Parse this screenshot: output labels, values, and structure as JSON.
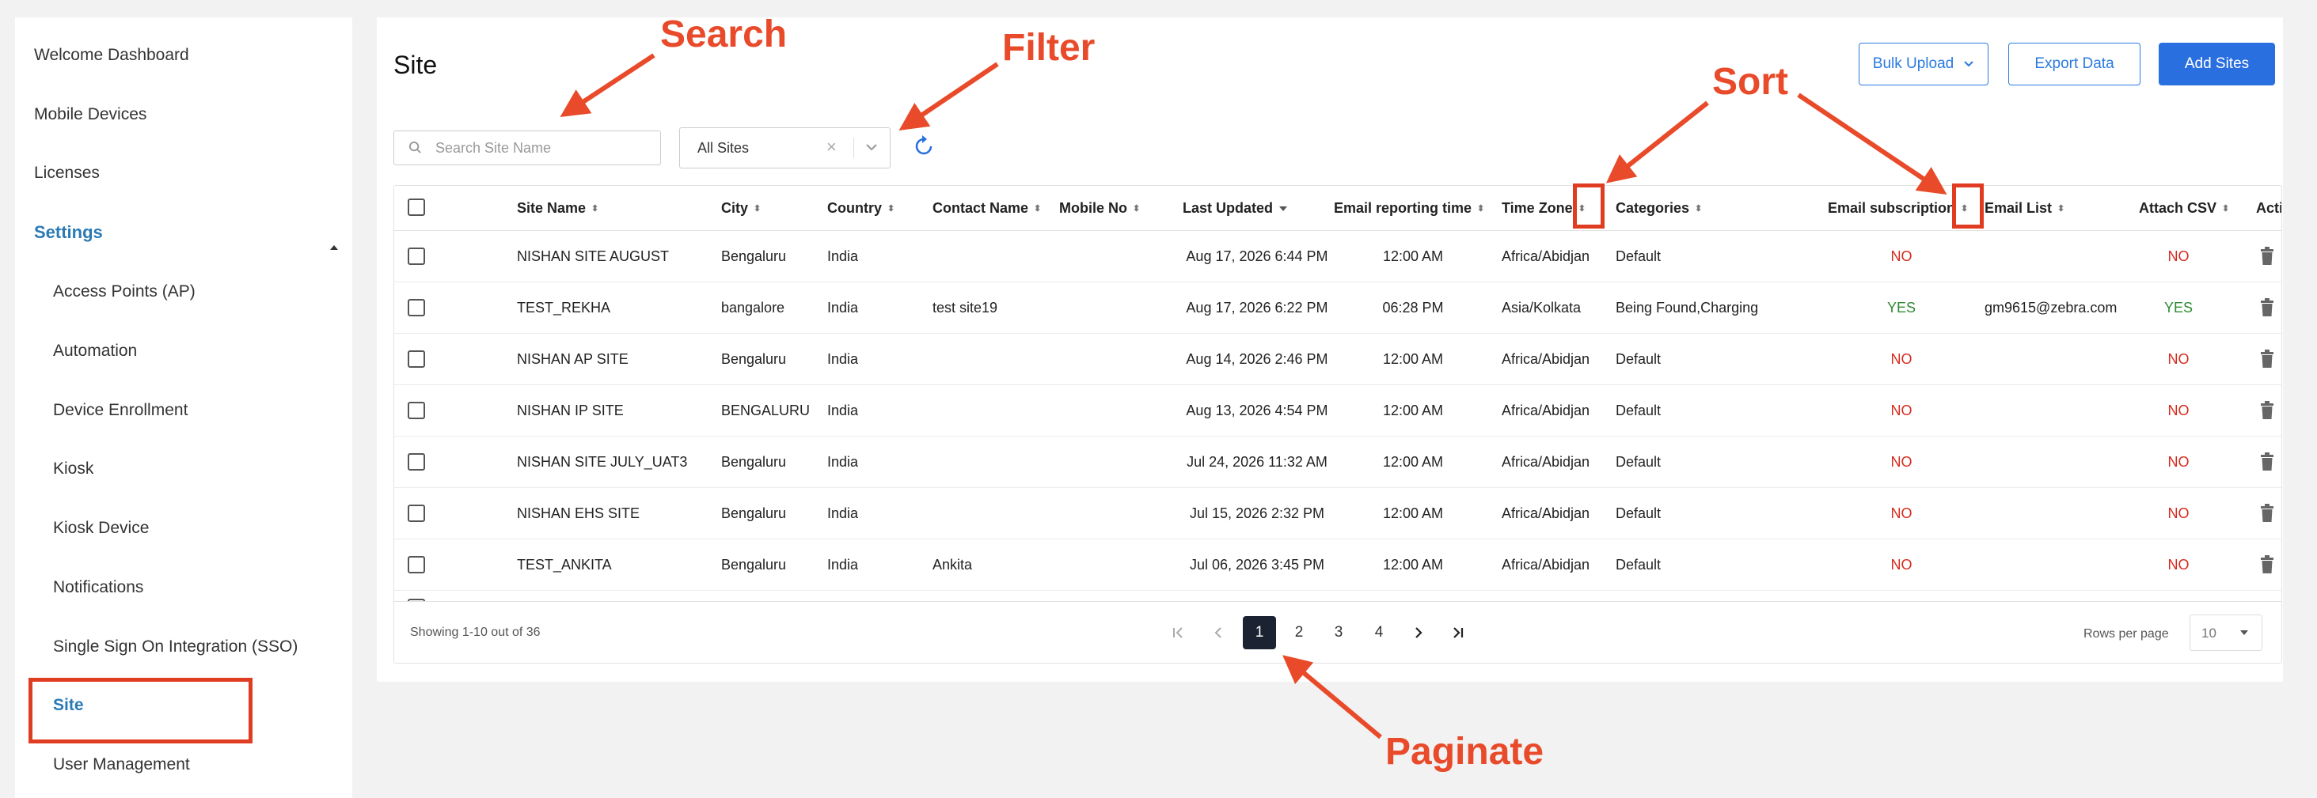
{
  "sidebar": {
    "items": [
      {
        "label": "Welcome Dashboard"
      },
      {
        "label": "Mobile Devices"
      },
      {
        "label": "Licenses"
      },
      {
        "label": "Settings"
      },
      {
        "label": "Access Points (AP)"
      },
      {
        "label": "Automation"
      },
      {
        "label": "Device Enrollment"
      },
      {
        "label": "Kiosk"
      },
      {
        "label": "Kiosk Device"
      },
      {
        "label": "Notifications"
      },
      {
        "label": "Single Sign On Integration (SSO)"
      },
      {
        "label": "Site"
      },
      {
        "label": "User Management"
      }
    ],
    "active_item": "Site"
  },
  "header": {
    "title": "Site",
    "bulk_upload_label": "Bulk Upload",
    "export_label": "Export Data",
    "add_label": "Add Sites"
  },
  "toolbar": {
    "search_placeholder": "Search Site Name",
    "search_value": "",
    "filter_value": "All Sites"
  },
  "table": {
    "columns": [
      "Site Name",
      "City",
      "Country",
      "Contact Name",
      "Mobile No",
      "Last Updated",
      "Email reporting time",
      "Time Zone",
      "Categories",
      "Email subscription",
      "Email List",
      "Attach CSV",
      "Acti"
    ],
    "rows": [
      {
        "site": "NISHAN SITE AUGUST",
        "city": "Bengaluru",
        "country": "India",
        "contact": "",
        "mobile": "",
        "updated": "Aug 17, 2026 6:44 PM",
        "email_time": "12:00 AM",
        "tz": "Africa/Abidjan",
        "categories": "Default",
        "subscription": "NO",
        "email_list": "",
        "csv": "NO"
      },
      {
        "site": "TEST_REKHA",
        "city": "bangalore",
        "country": "India",
        "contact": "test site19",
        "mobile": "",
        "updated": "Aug 17, 2026 6:22 PM",
        "email_time": "06:28 PM",
        "tz": "Asia/Kolkata",
        "categories": "Being Found,Charging",
        "subscription": "YES",
        "email_list": "gm9615@zebra.com",
        "csv": "YES"
      },
      {
        "site": "NISHAN AP SITE",
        "city": "Bengaluru",
        "country": "India",
        "contact": "",
        "mobile": "",
        "updated": "Aug 14, 2026 2:46 PM",
        "email_time": "12:00 AM",
        "tz": "Africa/Abidjan",
        "categories": "Default",
        "subscription": "NO",
        "email_list": "",
        "csv": "NO"
      },
      {
        "site": "NISHAN IP SITE",
        "city": "BENGALURU",
        "country": "India",
        "contact": "",
        "mobile": "",
        "updated": "Aug 13, 2026 4:54 PM",
        "email_time": "12:00 AM",
        "tz": "Africa/Abidjan",
        "categories": "Default",
        "subscription": "NO",
        "email_list": "",
        "csv": "NO"
      },
      {
        "site": "NISHAN SITE JULY_UAT3",
        "city": "Bengaluru",
        "country": "India",
        "contact": "",
        "mobile": "",
        "updated": "Jul 24, 2026 11:32 AM",
        "email_time": "12:00 AM",
        "tz": "Africa/Abidjan",
        "categories": "Default",
        "subscription": "NO",
        "email_list": "",
        "csv": "NO"
      },
      {
        "site": "NISHAN EHS SITE",
        "city": "Bengaluru",
        "country": "India",
        "contact": "",
        "mobile": "",
        "updated": "Jul 15, 2026 2:32 PM",
        "email_time": "12:00 AM",
        "tz": "Africa/Abidjan",
        "categories": "Default",
        "subscription": "NO",
        "email_list": "",
        "csv": "NO"
      },
      {
        "site": "TEST_ANKITA",
        "city": "Bengaluru",
        "country": "India",
        "contact": "Ankita",
        "mobile": "",
        "updated": "Jul 06, 2026 3:45 PM",
        "email_time": "12:00 AM",
        "tz": "Africa/Abidjan",
        "categories": "Default",
        "subscription": "NO",
        "email_list": "",
        "csv": "NO"
      }
    ]
  },
  "pagination": {
    "showing": "Showing 1-10 out of 36",
    "pages": [
      "1",
      "2",
      "3",
      "4"
    ],
    "current": "1",
    "rows_per_page_label": "Rows per page",
    "rows_per_page": "10"
  },
  "annotations": {
    "search": "Search",
    "filter": "Filter",
    "sort": "Sort",
    "paginate": "Paginate",
    "color": "#e84a2a"
  },
  "colors": {
    "accent": "#2a7ab5",
    "primary_button": "#2a6fe0",
    "no": "#d62b1f",
    "yes": "#2f8a33",
    "annotation": "#e03c22"
  }
}
